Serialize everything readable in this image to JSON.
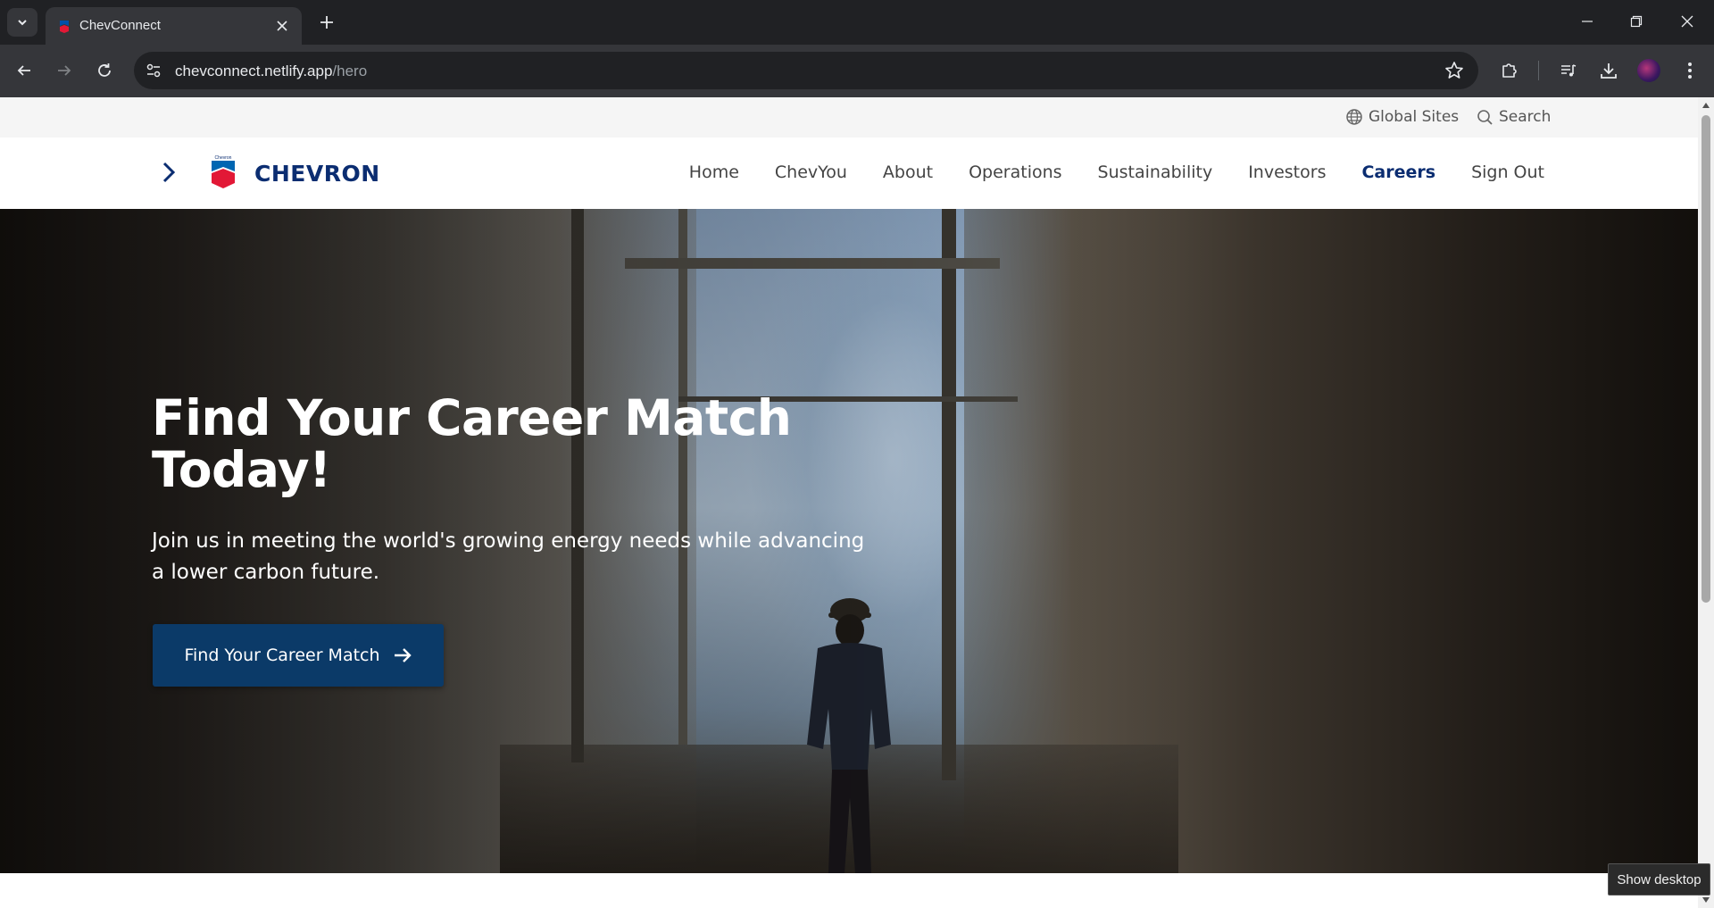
{
  "browser": {
    "tab": {
      "title": "ChevConnect"
    },
    "url": {
      "host": "chevconnect.netlify.app",
      "path": "/hero"
    },
    "icons": [
      "tab-list-icon",
      "close-icon",
      "plus-icon",
      "minimize-icon",
      "restore-icon",
      "window-close-icon",
      "back-icon",
      "forward-icon",
      "reload-icon",
      "site-info-icon",
      "star-icon",
      "extensions-icon",
      "media-icon",
      "download-icon",
      "profile-avatar",
      "more-icon"
    ]
  },
  "utility_bar": {
    "global_sites": "Global Sites",
    "search": "Search"
  },
  "header": {
    "logo_text": "CHEVRON",
    "logo_small": "Chevron",
    "nav": [
      {
        "label": "Home"
      },
      {
        "label": "ChevYou"
      },
      {
        "label": "About"
      },
      {
        "label": "Operations"
      },
      {
        "label": "Sustainability"
      },
      {
        "label": "Investors"
      },
      {
        "label": "Careers",
        "active": true
      },
      {
        "label": "Sign Out"
      }
    ]
  },
  "hero": {
    "title": "Find Your Career Match Today!",
    "subtitle": "Join us in meeting the world's growing energy needs while advancing a lower carbon future.",
    "cta_label": "Find Your Career Match"
  },
  "system": {
    "tooltip": "Show desktop"
  },
  "colors": {
    "brand_blue": "#0b2d71",
    "cta_blue": "#0b3a68",
    "chrome_dark": "#202124",
    "chrome_toolbar": "#35363a"
  }
}
